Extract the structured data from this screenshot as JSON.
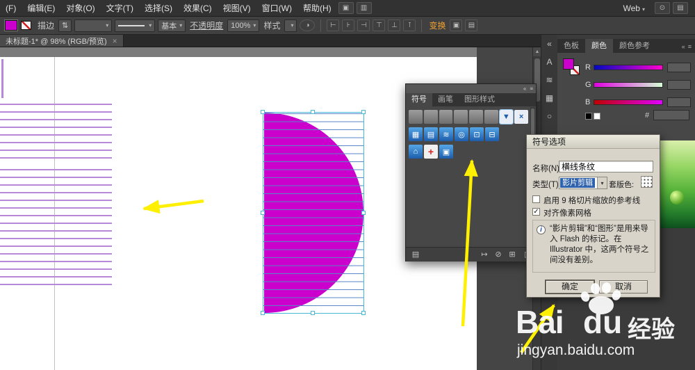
{
  "colors": {
    "fill_magenta": "#cc00cc",
    "stripe_violet": "#b888d8",
    "line_blue": "#5a86c8",
    "selection_cyan": "#46b8d8",
    "arrow_yellow": "#ffef00",
    "transform_orange": "#f0a030"
  },
  "ui": {
    "caret": "▾",
    "up_arrow": "▲",
    "stepper": "⇅"
  },
  "menu": {
    "items": [
      {
        "name": "menu-file",
        "label": "(F)"
      },
      {
        "name": "menu-edit",
        "label": "编辑(E)"
      },
      {
        "name": "menu-object",
        "label": "对象(O)"
      },
      {
        "name": "menu-type",
        "label": "文字(T)"
      },
      {
        "name": "menu-select",
        "label": "选择(S)"
      },
      {
        "name": "menu-effect",
        "label": "效果(C)"
      },
      {
        "name": "menu-view",
        "label": "视图(V)"
      },
      {
        "name": "menu-window",
        "label": "窗口(W)"
      },
      {
        "name": "menu-help",
        "label": "帮助(H)"
      }
    ],
    "app_icons": [
      {
        "name": "bridge-icon",
        "glyph": "▣"
      },
      {
        "name": "arrange-documents-icon",
        "glyph": "▥"
      }
    ],
    "workspace": "Web",
    "right_icons": [
      {
        "name": "search-icon",
        "glyph": "⊙"
      },
      {
        "name": "cs-live-icon",
        "glyph": "▤"
      }
    ]
  },
  "control_bar": {
    "stroke_label": "描边",
    "brush_value": "基本",
    "opacity_label": "不透明度",
    "opacity_value": "100%",
    "style_label": "样式",
    "transform_label": "变换",
    "align_icons": [
      {
        "name": "align-left-icon",
        "glyph": "⊢"
      },
      {
        "name": "align-center-icon",
        "glyph": "⊦"
      },
      {
        "name": "align-right-icon",
        "glyph": "⊣"
      },
      {
        "name": "align-top-icon",
        "glyph": "⊤"
      },
      {
        "name": "align-middle-icon",
        "glyph": "⊥"
      },
      {
        "name": "align-bottom-icon",
        "glyph": "⊺"
      }
    ],
    "extra_icons": [
      {
        "name": "isolate-icon",
        "glyph": "▣"
      },
      {
        "name": "options-icon",
        "glyph": "▤"
      }
    ]
  },
  "document_tab": {
    "title": "未标题-1* @ 98% (RGB/预览)",
    "close": "×"
  },
  "symbols_panel": {
    "header_icons": [
      {
        "name": "collapse-panel-icon",
        "glyph": "«"
      },
      {
        "name": "panel-menu-icon",
        "glyph": "≡"
      }
    ],
    "tabs": [
      {
        "name": "tab-symbols",
        "label": "符号",
        "cls": "sym-tab-active"
      },
      {
        "name": "tab-brushes",
        "label": "画笔"
      },
      {
        "name": "tab-graphic-styles",
        "label": "图形样式"
      }
    ],
    "row1": [
      {
        "name": "web-bar-symbol-1",
        "glyph": "",
        "cls": "s-blank"
      },
      {
        "name": "web-bar-symbol-2",
        "glyph": "",
        "cls": "s-blank"
      },
      {
        "name": "web-bar-symbol-3",
        "glyph": "",
        "cls": "s-blank"
      },
      {
        "name": "web-bar-symbol-4",
        "glyph": "",
        "cls": "s-blank"
      },
      {
        "name": "web-bar-symbol-5",
        "glyph": "",
        "cls": "s-blank"
      },
      {
        "name": "web-bar-symbol-6",
        "glyph": "",
        "cls": "s-blank"
      },
      {
        "name": "dropdown-button-symbol",
        "glyph": "▼",
        "cls": "s-light s-selected"
      },
      {
        "name": "close-button-symbol",
        "glyph": "×",
        "cls": "s-light"
      }
    ],
    "row2": [
      {
        "name": "table-symbol",
        "glyph": "▦",
        "cls": "s-blue"
      },
      {
        "name": "calendar-symbol",
        "glyph": "▤",
        "cls": "s-blue"
      },
      {
        "name": "rss-symbol",
        "glyph": "≋",
        "cls": "s-blue"
      },
      {
        "name": "search-symbol",
        "glyph": "◎",
        "cls": "s-blue"
      },
      {
        "name": "monitor-symbol",
        "glyph": "⊡",
        "cls": "s-blue"
      },
      {
        "name": "cart-symbol",
        "glyph": "⊟",
        "cls": "s-blue"
      }
    ],
    "row3": [
      {
        "name": "home-symbol",
        "glyph": "⌂",
        "cls": "s-blue"
      },
      {
        "name": "medical-symbol",
        "glyph": "+",
        "cls": "s-med"
      },
      {
        "name": "printer-symbol",
        "glyph": "▣",
        "cls": "s-blue"
      }
    ],
    "library_icon": "▤",
    "footer_icons": [
      {
        "name": "place-symbol-icon",
        "glyph": "↦"
      },
      {
        "name": "break-link-icon",
        "glyph": "⊘"
      },
      {
        "name": "new-symbol-icon",
        "glyph": "⊞"
      },
      {
        "name": "delete-symbol-icon",
        "glyph": "▯"
      }
    ]
  },
  "dialog": {
    "title": "符号选项",
    "name_label": "名称(N):",
    "name_value": "横线条纹",
    "type_label": "类型(T):",
    "type_value": "影片剪辑",
    "registration_label": "套版色:",
    "option_9slice": "启用 9 格切片缩放的参考线",
    "option_pixel_grid": "对齐像素网格",
    "check_glyph": "✓",
    "info_icon": "i",
    "info_text": "“影片剪辑”和“图形”是用来导入 Flash 的标记。在 Illustrator 中，这两个符号之间没有差别。",
    "ok_label": "确定",
    "cancel_label": "取消"
  },
  "right_panel": {
    "tabs": [
      {
        "name": "tab-swatches",
        "label": "色板"
      },
      {
        "name": "tab-color",
        "label": "颜色",
        "cls": "rp-tab-active"
      },
      {
        "name": "tab-color-guide",
        "label": "颜色参考"
      }
    ],
    "header_icons": [
      {
        "name": "collapse-panels-icon",
        "glyph": "«"
      },
      {
        "name": "color-panel-menu-icon",
        "glyph": "≡"
      }
    ],
    "channels": [
      {
        "name": "channel-r",
        "label": "R",
        "cls": "bar-r"
      },
      {
        "name": "channel-g",
        "label": "G",
        "cls": "bar-g"
      },
      {
        "name": "channel-b",
        "label": "B",
        "cls": "bar-b"
      }
    ],
    "hex_label": "#"
  },
  "dock": {
    "items": [
      {
        "name": "expand-dock-icon",
        "glyph": "«"
      },
      {
        "name": "character-panel-icon",
        "glyph": "A"
      },
      {
        "name": "stroke-panel-icon",
        "glyph": "≋"
      },
      {
        "name": "swatches-panel-icon",
        "glyph": "▦"
      },
      {
        "name": "appearance-panel-icon",
        "glyph": "○"
      }
    ]
  },
  "watermark": {
    "brand_left": "Bai",
    "brand_right": "du",
    "suffix": "经验",
    "url": "jingyan.baidu.com"
  }
}
